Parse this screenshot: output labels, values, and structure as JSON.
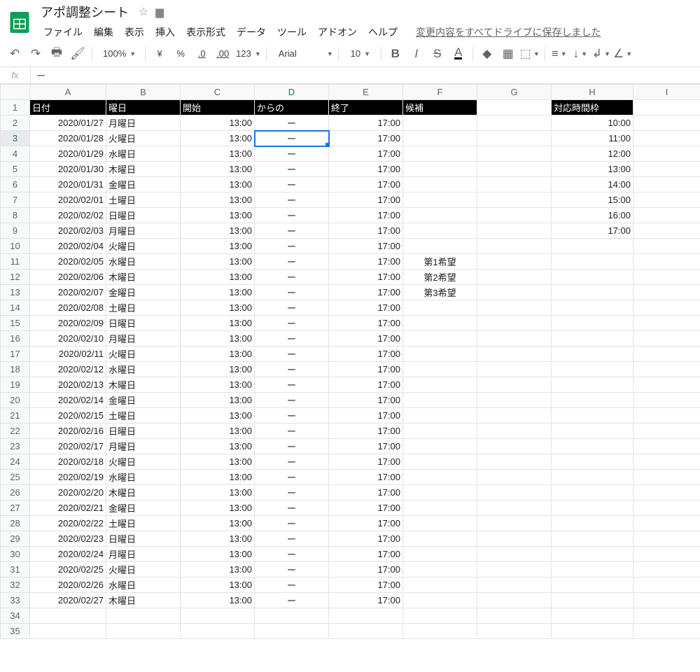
{
  "doc": {
    "title": "アポ調整シート"
  },
  "menus": {
    "file": "ファイル",
    "edit": "編集",
    "view": "表示",
    "insert": "挿入",
    "format": "表示形式",
    "data": "データ",
    "tools": "ツール",
    "addons": "アドオン",
    "help": "ヘルプ",
    "save_status": "変更内容をすべてドライブに保存しました"
  },
  "toolbar": {
    "zoom": "100%",
    "currency": "¥",
    "percent": "%",
    "dec_dec": ".0",
    "dec_inc": ".00",
    "numfmt": "123",
    "font": "Arial",
    "size": "10"
  },
  "formula": {
    "fx": "fx",
    "value": "ー"
  },
  "columns": [
    "A",
    "B",
    "C",
    "D",
    "E",
    "F",
    "G",
    "H",
    "I"
  ],
  "active": {
    "col": "D",
    "row": 3
  },
  "header_row": {
    "A": "日付",
    "B": "曜日",
    "C": "開始",
    "D": "からの",
    "E": "終了",
    "F": "候補",
    "G": "",
    "H": "対応時間枠",
    "I": ""
  },
  "rows": [
    {
      "A": "2020/01/27",
      "B": "月曜日",
      "C": "13:00",
      "D": "ー",
      "E": "17:00",
      "F": "",
      "G": "",
      "H": "10:00"
    },
    {
      "A": "2020/01/28",
      "B": "火曜日",
      "C": "13:00",
      "D": "ー",
      "E": "17:00",
      "F": "",
      "G": "",
      "H": "11:00"
    },
    {
      "A": "2020/01/29",
      "B": "水曜日",
      "C": "13:00",
      "D": "ー",
      "E": "17:00",
      "F": "",
      "G": "",
      "H": "12:00"
    },
    {
      "A": "2020/01/30",
      "B": "木曜日",
      "C": "13:00",
      "D": "ー",
      "E": "17:00",
      "F": "",
      "G": "",
      "H": "13:00"
    },
    {
      "A": "2020/01/31",
      "B": "金曜日",
      "C": "13:00",
      "D": "ー",
      "E": "17:00",
      "F": "",
      "G": "",
      "H": "14:00"
    },
    {
      "A": "2020/02/01",
      "B": "土曜日",
      "C": "13:00",
      "D": "ー",
      "E": "17:00",
      "F": "",
      "G": "",
      "H": "15:00"
    },
    {
      "A": "2020/02/02",
      "B": "日曜日",
      "C": "13:00",
      "D": "ー",
      "E": "17:00",
      "F": "",
      "G": "",
      "H": "16:00"
    },
    {
      "A": "2020/02/03",
      "B": "月曜日",
      "C": "13:00",
      "D": "ー",
      "E": "17:00",
      "F": "",
      "G": "",
      "H": "17:00"
    },
    {
      "A": "2020/02/04",
      "B": "火曜日",
      "C": "13:00",
      "D": "ー",
      "E": "17:00",
      "F": "",
      "G": "",
      "H": ""
    },
    {
      "A": "2020/02/05",
      "B": "水曜日",
      "C": "13:00",
      "D": "ー",
      "E": "17:00",
      "F": "第1希望",
      "G": "",
      "H": ""
    },
    {
      "A": "2020/02/06",
      "B": "木曜日",
      "C": "13:00",
      "D": "ー",
      "E": "17:00",
      "F": "第2希望",
      "G": "",
      "H": ""
    },
    {
      "A": "2020/02/07",
      "B": "金曜日",
      "C": "13:00",
      "D": "ー",
      "E": "17:00",
      "F": "第3希望",
      "G": "",
      "H": ""
    },
    {
      "A": "2020/02/08",
      "B": "土曜日",
      "C": "13:00",
      "D": "ー",
      "E": "17:00",
      "F": "",
      "G": "",
      "H": ""
    },
    {
      "A": "2020/02/09",
      "B": "日曜日",
      "C": "13:00",
      "D": "ー",
      "E": "17:00",
      "F": "",
      "G": "",
      "H": ""
    },
    {
      "A": "2020/02/10",
      "B": "月曜日",
      "C": "13:00",
      "D": "ー",
      "E": "17:00",
      "F": "",
      "G": "",
      "H": ""
    },
    {
      "A": "2020/02/11",
      "B": "火曜日",
      "C": "13:00",
      "D": "ー",
      "E": "17:00",
      "F": "",
      "G": "",
      "H": ""
    },
    {
      "A": "2020/02/12",
      "B": "水曜日",
      "C": "13:00",
      "D": "ー",
      "E": "17:00",
      "F": "",
      "G": "",
      "H": ""
    },
    {
      "A": "2020/02/13",
      "B": "木曜日",
      "C": "13:00",
      "D": "ー",
      "E": "17:00",
      "F": "",
      "G": "",
      "H": ""
    },
    {
      "A": "2020/02/14",
      "B": "金曜日",
      "C": "13:00",
      "D": "ー",
      "E": "17:00",
      "F": "",
      "G": "",
      "H": ""
    },
    {
      "A": "2020/02/15",
      "B": "土曜日",
      "C": "13:00",
      "D": "ー",
      "E": "17:00",
      "F": "",
      "G": "",
      "H": ""
    },
    {
      "A": "2020/02/16",
      "B": "日曜日",
      "C": "13:00",
      "D": "ー",
      "E": "17:00",
      "F": "",
      "G": "",
      "H": ""
    },
    {
      "A": "2020/02/17",
      "B": "月曜日",
      "C": "13:00",
      "D": "ー",
      "E": "17:00",
      "F": "",
      "G": "",
      "H": ""
    },
    {
      "A": "2020/02/18",
      "B": "火曜日",
      "C": "13:00",
      "D": "ー",
      "E": "17:00",
      "F": "",
      "G": "",
      "H": ""
    },
    {
      "A": "2020/02/19",
      "B": "水曜日",
      "C": "13:00",
      "D": "ー",
      "E": "17:00",
      "F": "",
      "G": "",
      "H": ""
    },
    {
      "A": "2020/02/20",
      "B": "木曜日",
      "C": "13:00",
      "D": "ー",
      "E": "17:00",
      "F": "",
      "G": "",
      "H": ""
    },
    {
      "A": "2020/02/21",
      "B": "金曜日",
      "C": "13:00",
      "D": "ー",
      "E": "17:00",
      "F": "",
      "G": "",
      "H": ""
    },
    {
      "A": "2020/02/22",
      "B": "土曜日",
      "C": "13:00",
      "D": "ー",
      "E": "17:00",
      "F": "",
      "G": "",
      "H": ""
    },
    {
      "A": "2020/02/23",
      "B": "日曜日",
      "C": "13:00",
      "D": "ー",
      "E": "17:00",
      "F": "",
      "G": "",
      "H": ""
    },
    {
      "A": "2020/02/24",
      "B": "月曜日",
      "C": "13:00",
      "D": "ー",
      "E": "17:00",
      "F": "",
      "G": "",
      "H": ""
    },
    {
      "A": "2020/02/25",
      "B": "火曜日",
      "C": "13:00",
      "D": "ー",
      "E": "17:00",
      "F": "",
      "G": "",
      "H": ""
    },
    {
      "A": "2020/02/26",
      "B": "水曜日",
      "C": "13:00",
      "D": "ー",
      "E": "17:00",
      "F": "",
      "G": "",
      "H": ""
    },
    {
      "A": "2020/02/27",
      "B": "木曜日",
      "C": "13:00",
      "D": "ー",
      "E": "17:00",
      "F": "",
      "G": "",
      "H": ""
    }
  ],
  "blank_rows": 2,
  "align": {
    "A": "r",
    "B": "l",
    "C": "r",
    "D": "c",
    "E": "r",
    "F": "c",
    "G": "r",
    "H": "r",
    "I": "l"
  }
}
